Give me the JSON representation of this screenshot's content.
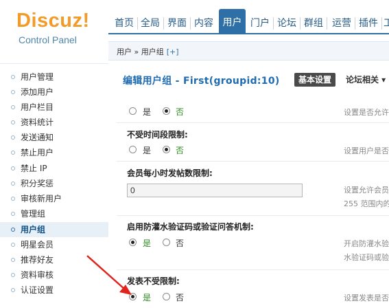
{
  "logo": {
    "title": "Discuz!",
    "subtitle": "Control Panel"
  },
  "nav": {
    "items": [
      "首页",
      "全局",
      "界面",
      "内容",
      "用户",
      "门户",
      "论坛",
      "群组",
      "运营",
      "插件",
      "工"
    ],
    "active": "用户"
  },
  "sidebar": {
    "items": [
      "用户管理",
      "添加用户",
      "用户栏目",
      "资料统计",
      "发送通知",
      "禁止用户",
      "禁止 IP",
      "积分奖惩",
      "审核新用户",
      "管理组",
      "用户组",
      "明星会员",
      "推荐好友",
      "资料审核",
      "认证设置"
    ],
    "active": "用户组"
  },
  "breadcrumb": {
    "text": "用户 » 用户组",
    "plus": "[+]"
  },
  "page": {
    "title": "编辑用户组 - First(groupid:10)",
    "tab_basic": "基本设置",
    "tab_forum": "论坛相关 ▾"
  },
  "form": {
    "row1": {
      "yes": "是",
      "no": "否",
      "value": "否",
      "hint": "设置是否允许"
    },
    "row2": {
      "label": "不受时间段限制:",
      "yes": "是",
      "no": "否",
      "value": "否",
      "hint": "设置用户是否"
    },
    "row3": {
      "label": "会员每小时发帖数限制:",
      "value": "0",
      "hint_line1": "设置允许会员",
      "hint_line2": "255 范围内的"
    },
    "row4": {
      "label": "启用防灌水验证码或验证问答机制:",
      "yes": "是",
      "no": "否",
      "value": "是",
      "hint_line1": "开启防灌水验",
      "hint_line2": "水验证码或验"
    },
    "row5": {
      "label": "发表不受限制:",
      "yes": "是",
      "no": "否",
      "value": "是",
      "hint": "设置发表是否"
    }
  },
  "colors": {
    "accent": "#2d6fa6",
    "logo": "#f39a28",
    "arrow": "#e0231d"
  }
}
